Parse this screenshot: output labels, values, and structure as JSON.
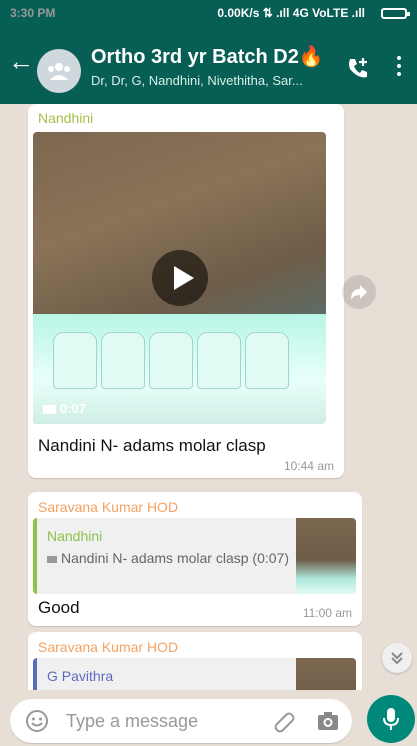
{
  "status_bar": {
    "time": "3:30 PM",
    "indicators": "0.00K/s ⇅ .ıll 4G VoLTE .ıll"
  },
  "header": {
    "title": "Ortho 3rd yr Batch D2🔥",
    "subtitle": "Dr, Dr, G, Nandhini, Nivethitha, Sar..."
  },
  "messages": [
    {
      "sender": "Nandhini",
      "sender_color": "#a5c04a",
      "video_duration": "0:07",
      "caption": "Nandini N- adams molar clasp",
      "time": "10:44 am"
    },
    {
      "sender": "Saravana Kumar HOD",
      "sender_color": "#f4a261",
      "quoted": {
        "sender": "Nandhini",
        "text": "Nandini N- adams molar clasp (0:07)"
      },
      "text": "Good",
      "time": "11:00 am"
    },
    {
      "sender": "Saravana Kumar HOD",
      "sender_color": "#f4a261",
      "quoted": {
        "sender": "G Pavithra"
      }
    }
  ],
  "composer": {
    "placeholder": "Type a message"
  }
}
